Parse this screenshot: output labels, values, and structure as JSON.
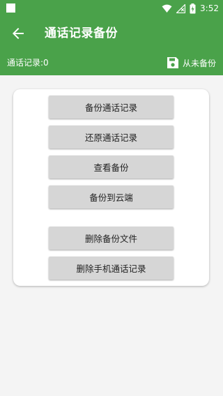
{
  "status_bar": {
    "time": "3:52",
    "icons": [
      "notification-square-icon",
      "wifi-icon",
      "signal-icon",
      "battery-charging-icon"
    ]
  },
  "app_bar": {
    "title": "通话记录备份",
    "back_icon": "arrow-left-icon"
  },
  "info_bar": {
    "call_count_label": "通话记录:0",
    "backup_status_label": "从未备份",
    "backup_icon": "floppy-disk-icon"
  },
  "actions": [
    {
      "label": "备份通话记录"
    },
    {
      "label": "还原通话记录"
    },
    {
      "label": "查看备份"
    },
    {
      "label": "备份到云端"
    },
    {
      "label": "删除备份文件"
    },
    {
      "label": "删除手机通话记录"
    }
  ],
  "colors": {
    "primary": "#4aa24a",
    "background": "#f4f4f4",
    "button": "#d6d6d6",
    "card": "#ffffff"
  }
}
